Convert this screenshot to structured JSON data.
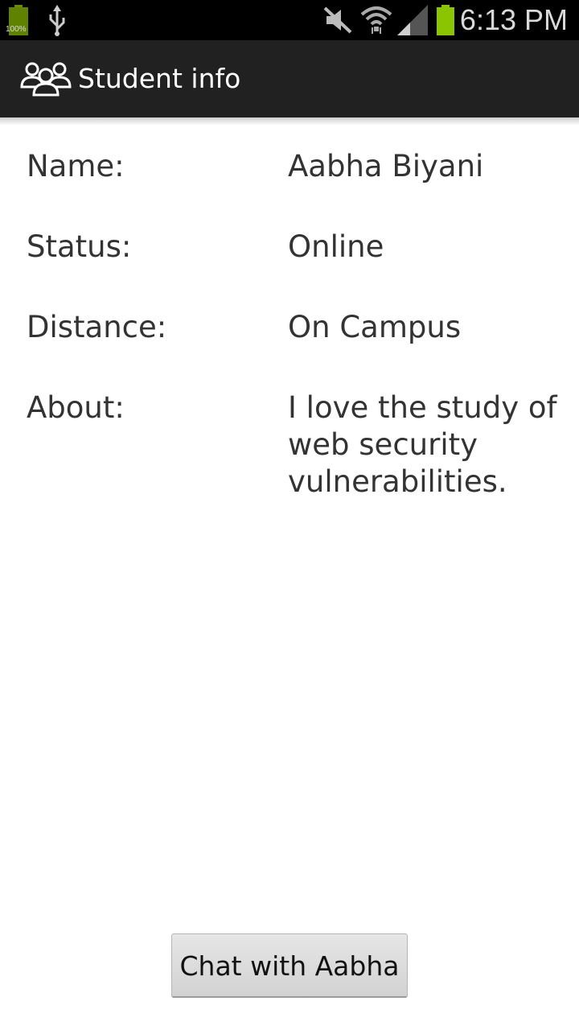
{
  "status_bar": {
    "battery_percent": "100%",
    "time": "6:13 PM",
    "icons": [
      "battery-icon",
      "usb-icon",
      "mute-icon",
      "wifi-icon",
      "signal-icon",
      "battery-icon"
    ]
  },
  "action_bar": {
    "title": "Student info",
    "icon": "group-icon"
  },
  "student": {
    "name_label": "Name:",
    "name_value": "Aabha Biyani",
    "status_label": "Status:",
    "status_value": "Online",
    "distance_label": "Distance:",
    "distance_value": "On Campus",
    "about_label": "About:",
    "about_value": "I love the study of web security vulnerabilities."
  },
  "chat_button": {
    "label": "Chat with Aabha"
  },
  "colors": {
    "action_bar": "#212121",
    "status_bar": "#000000",
    "battery_green": "#8bc400",
    "text": "#333333"
  }
}
